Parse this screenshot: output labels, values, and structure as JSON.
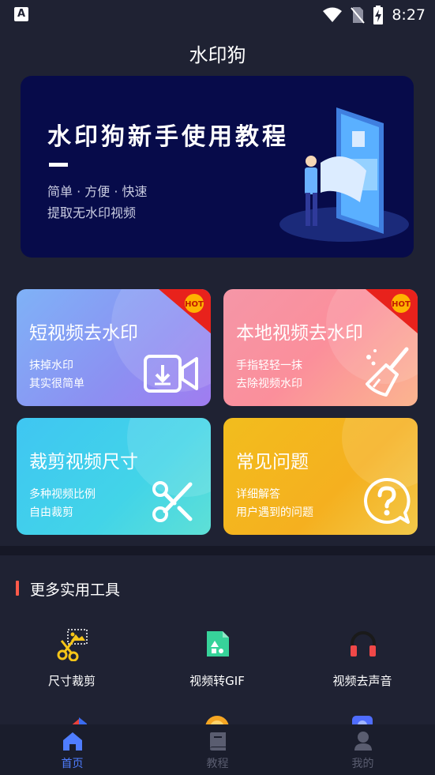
{
  "status_bar": {
    "time": "8:27"
  },
  "app_title": "水印狗",
  "banner": {
    "title": "水印狗新手使用教程",
    "subtitle_1": "简单 · 方便 · 快速",
    "subtitle_2": "提取无水印视频"
  },
  "cards": [
    {
      "title": "短视频去水印",
      "line1": "抹掉水印",
      "line2": "其实很简单",
      "badge": "HOT",
      "icon": "video-download-icon"
    },
    {
      "title": "本地视频去水印",
      "line1": "手指轻轻一抹",
      "line2": "去除视频水印",
      "badge": "HOT",
      "icon": "broom-icon"
    },
    {
      "title": "裁剪视频尺寸",
      "line1": "多种视频比例",
      "line2": "自由裁剪",
      "icon": "scissors-icon"
    },
    {
      "title": "常见问题",
      "line1": "详细解答",
      "line2": "用户遇到的问题",
      "icon": "question-bubble-icon"
    }
  ],
  "more_tools": {
    "section_title": "更多实用工具",
    "items": [
      {
        "label": "尺寸裁剪",
        "icon": "crop-scissors-icon"
      },
      {
        "label": "视频转GIF",
        "icon": "gif-file-icon"
      },
      {
        "label": "视频去声音",
        "icon": "headphones-icon"
      }
    ]
  },
  "tab_bar": {
    "items": [
      {
        "label": "首页",
        "icon": "home-icon",
        "active": true
      },
      {
        "label": "教程",
        "icon": "book-icon",
        "active": false
      },
      {
        "label": "我的",
        "icon": "user-icon",
        "active": false
      }
    ]
  },
  "colors": {
    "background": "#1f2233",
    "accent": "#4f7dff",
    "tab_inactive": "#5a5d70",
    "section_marker": "#ff5a4a"
  }
}
